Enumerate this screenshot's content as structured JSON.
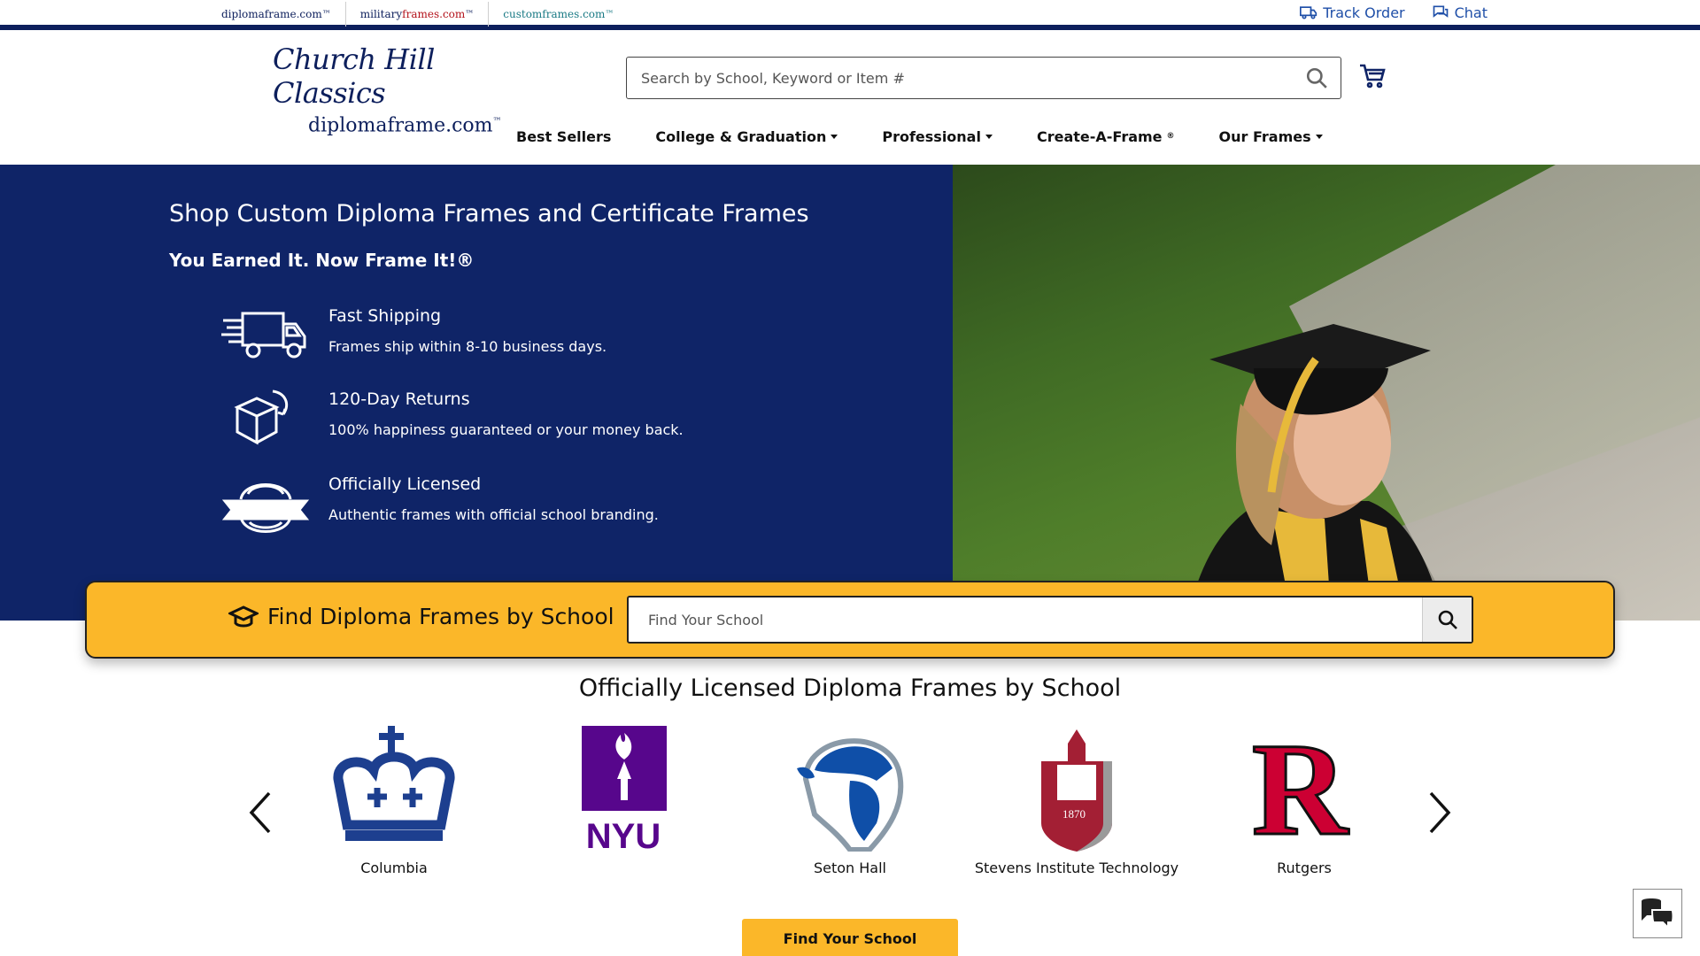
{
  "sister_sites": [
    {
      "prefix": "",
      "accent": "",
      "main": "diplomaframe.com",
      "suffix": "™"
    },
    {
      "prefix": "military",
      "accent": "frames",
      "main": ".com",
      "suffix": "™"
    },
    {
      "prefix": "",
      "accent": "",
      "main": "customframes.com",
      "suffix": "™"
    }
  ],
  "top_links": {
    "track_order": "Track Order",
    "chat": "Chat"
  },
  "logo": {
    "script": "Church Hill Classics",
    "url": "diplomaframe.com",
    "tm": "™"
  },
  "search": {
    "placeholder": "Search by School, Keyword or Item #"
  },
  "nav": {
    "best_sellers": "Best Sellers",
    "college": "College & Graduation",
    "professional": "Professional",
    "create": "Create-A-Frame",
    "create_mark": "®",
    "our_frames": "Our Frames"
  },
  "hero": {
    "title": "Shop Custom Diploma Frames and Certificate Frames",
    "subtitle": "You Earned It. Now Frame It!®",
    "features": [
      {
        "title": "Fast Shipping",
        "desc": "Frames ship within 8-10 business days.",
        "icon": "truck-icon"
      },
      {
        "title": "120-Day Returns",
        "desc": "100% happiness guaranteed or your money back.",
        "icon": "box-return-icon"
      },
      {
        "title": "Officially Licensed",
        "desc": "Authentic frames with official school branding.",
        "icon": "license-badge-icon"
      }
    ]
  },
  "find_bar": {
    "label": "Find Diploma Frames by School",
    "placeholder": "Find Your School"
  },
  "schools": {
    "title": "Officially Licensed Diploma Frames by School",
    "items": [
      {
        "name": "Columbia",
        "color": "#1d3f8f"
      },
      {
        "name": "",
        "logo_text": "NYU",
        "color": "#57068c"
      },
      {
        "name": "Seton Hall",
        "color": "#0f4fa8"
      },
      {
        "name": "Stevens Institute Technology",
        "color": "#a31f34",
        "logo_text": "1870"
      },
      {
        "name": "Rutgers",
        "logo_text": "R",
        "color": "#cc0033"
      }
    ]
  },
  "cta": {
    "label": "Find Your School"
  },
  "colors": {
    "navy": "#0f2467",
    "gold": "#fbb729",
    "link_blue": "#1f4fa8"
  }
}
